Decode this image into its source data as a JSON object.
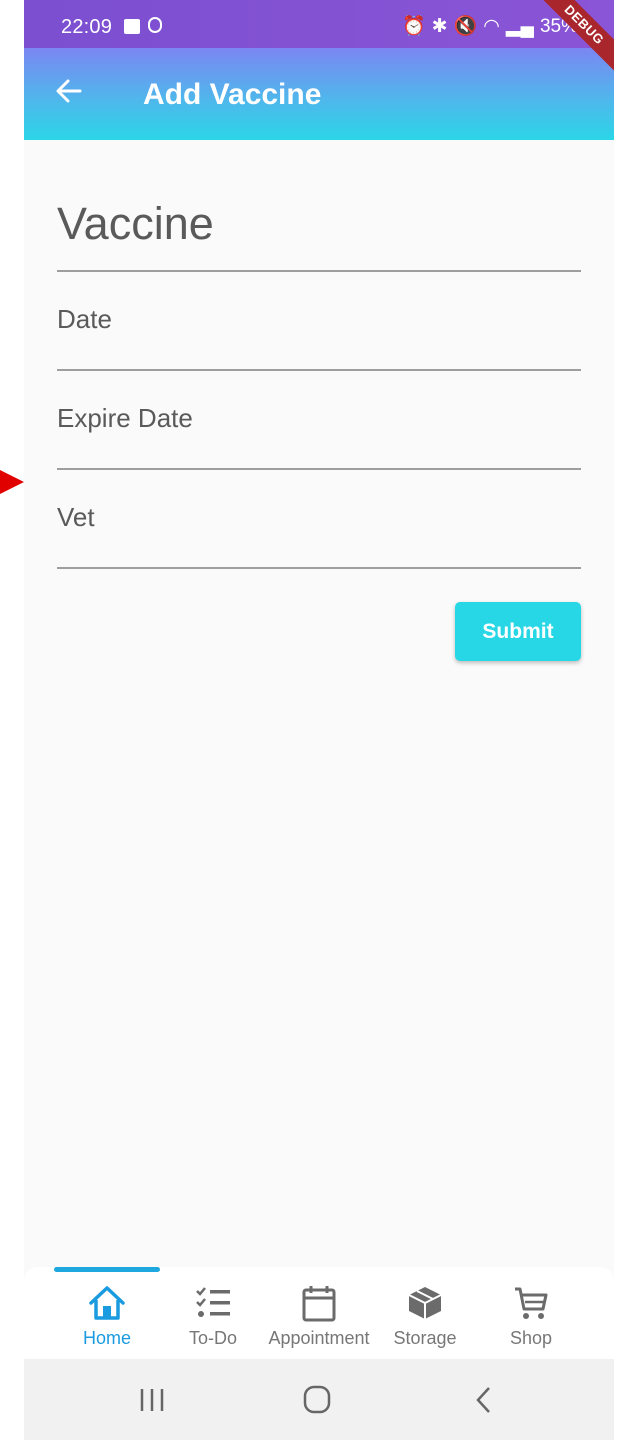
{
  "status_bar": {
    "time": "22:09",
    "battery": "35%"
  },
  "app_bar": {
    "title": "Add Vaccine",
    "debug_banner": "DEBUG",
    "back_icon": "arrow-left-icon"
  },
  "form": {
    "vaccine_placeholder": "Vaccine",
    "date_placeholder": "Date",
    "expire_date_placeholder": "Expire Date",
    "vet_placeholder": "Vet",
    "submit_label": "Submit"
  },
  "bottom_nav": {
    "items": [
      {
        "label": "Home",
        "icon": "home-icon",
        "active": true
      },
      {
        "label": "To-Do",
        "icon": "checklist-icon"
      },
      {
        "label": "Appointment",
        "icon": "calendar-icon"
      },
      {
        "label": "Storage",
        "icon": "box-icon"
      },
      {
        "label": "Shop",
        "icon": "cart-icon"
      }
    ]
  },
  "colors": {
    "primary": "#28d7e6",
    "active_nav": "#1a9be0",
    "status_bar": "#7b4fd0"
  }
}
